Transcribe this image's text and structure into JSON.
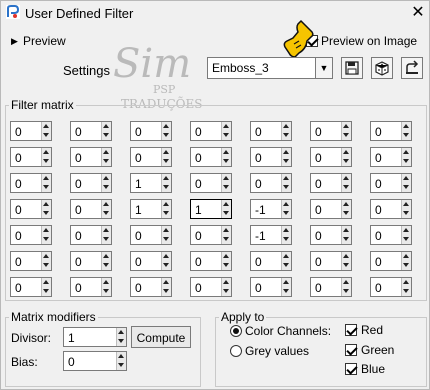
{
  "window": {
    "title": "User Defined Filter",
    "close_glyph": "✕"
  },
  "preview": {
    "label": "Preview",
    "arrow_glyph": "▶"
  },
  "preview_on_image": {
    "label": "Preview on Image",
    "checked": true
  },
  "settings": {
    "label": "Settings",
    "value": "Emboss_3"
  },
  "watermark": {
    "big": "Sim",
    "small": "PSP",
    "sub": "TRADUÇÕES"
  },
  "filter_matrix": {
    "title": "Filter matrix",
    "rows": [
      [
        "0",
        "0",
        "0",
        "0",
        "0",
        "0",
        "0"
      ],
      [
        "0",
        "0",
        "0",
        "0",
        "0",
        "0",
        "0"
      ],
      [
        "0",
        "0",
        "1",
        "0",
        "0",
        "0",
        "0"
      ],
      [
        "0",
        "0",
        "1",
        "1",
        "-1",
        "0",
        "0"
      ],
      [
        "0",
        "0",
        "0",
        "0",
        "-1",
        "0",
        "0"
      ],
      [
        "0",
        "0",
        "0",
        "0",
        "0",
        "0",
        "0"
      ],
      [
        "0",
        "0",
        "0",
        "0",
        "0",
        "0",
        "0"
      ]
    ]
  },
  "matrix_modifiers": {
    "title": "Matrix modifiers",
    "divisor_label": "Divisor:",
    "divisor_value": "1",
    "bias_label": "Bias:",
    "bias_value": "0",
    "compute_label": "Compute"
  },
  "apply_to": {
    "title": "Apply to",
    "color_channels_label": "Color Channels:",
    "grey_values_label": "Grey values",
    "selected": "color_channels",
    "channels": [
      {
        "label": "Red",
        "checked": true
      },
      {
        "label": "Green",
        "checked": true
      },
      {
        "label": "Blue",
        "checked": true
      }
    ]
  },
  "colors": {
    "window_bg": "#f0f0f0",
    "cursor": "#f5c400"
  }
}
